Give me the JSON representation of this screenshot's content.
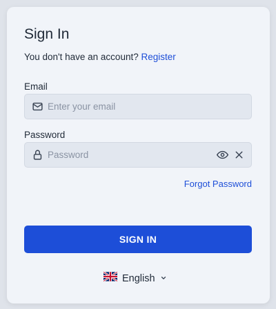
{
  "title": "Sign In",
  "account_prompt": {
    "text": "You don't have an account?",
    "link": "Register"
  },
  "email": {
    "label": "Email",
    "placeholder": "Enter your email",
    "value": "",
    "icon": "mail-icon"
  },
  "password": {
    "label": "Password",
    "placeholder": "Password",
    "value": "",
    "icon": "lock-icon",
    "actions": [
      "eye-icon",
      "close-icon"
    ]
  },
  "forgot_password": "Forgot Password",
  "submit_label": "SIGN IN",
  "language": {
    "selected": "English",
    "flag": "uk-flag-icon"
  },
  "colors": {
    "accent": "#1d4ed8",
    "card_bg": "#f1f4f9",
    "input_bg": "#e2e7ef",
    "page_bg": "#dfe3ea"
  }
}
